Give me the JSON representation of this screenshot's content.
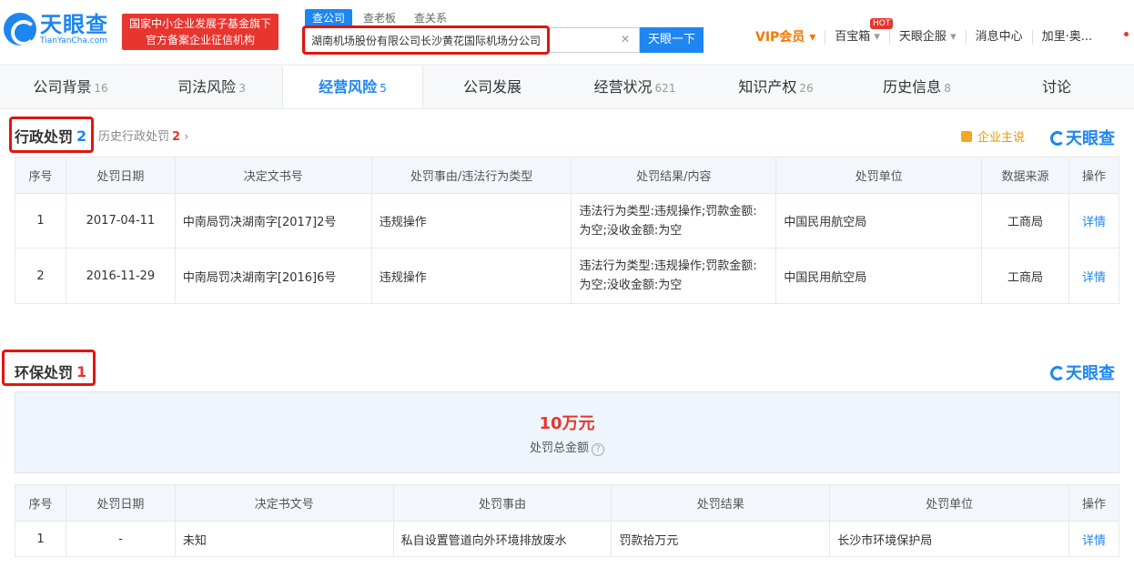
{
  "header": {
    "logo_cn": "天眼查",
    "logo_en": "TianYanCha.com",
    "badge_line1": "国家中小企业发展子基金旗下",
    "badge_line2": "官方备案企业征信机构",
    "search_tabs": [
      "查公司",
      "查老板",
      "查关系"
    ],
    "search_value": "湖南机场股份有限公司长沙黄花国际机场分公司",
    "search_button": "天眼一下",
    "vip": "VIP会员",
    "baobao": "百宝箱",
    "hot": "HOT",
    "qifu": "天眼企服",
    "messages": "消息中心",
    "user": "加里·奥..."
  },
  "tabs": [
    {
      "label": "公司背景",
      "count": "16"
    },
    {
      "label": "司法风险",
      "count": "3"
    },
    {
      "label": "经营风险",
      "count": "5"
    },
    {
      "label": "公司发展",
      "count": ""
    },
    {
      "label": "经营状况",
      "count": "621"
    },
    {
      "label": "知识产权",
      "count": "26"
    },
    {
      "label": "历史信息",
      "count": "8"
    },
    {
      "label": "讨论",
      "count": ""
    }
  ],
  "admin": {
    "title": "行政处罚",
    "count": "2",
    "history_label": "历史行政处罚",
    "history_count": "2",
    "promo": "企业主说",
    "brand": "天眼查",
    "headers": [
      "序号",
      "处罚日期",
      "决定文书号",
      "处罚事由/违法行为类型",
      "处罚结果/内容",
      "处罚单位",
      "数据来源",
      "操作"
    ],
    "rows": [
      {
        "no": "1",
        "date": "2017-04-11",
        "doc": "中南局罚决湖南字[2017]2号",
        "reason": "违规操作",
        "result_l1": "违法行为类型:违规操作;罚款金额:",
        "result_l2": "为空;没收金额:为空",
        "unit": "中国民用航空局",
        "source": "工商局",
        "action": "详情"
      },
      {
        "no": "2",
        "date": "2016-11-29",
        "doc": "中南局罚决湖南字[2016]6号",
        "reason": "违规操作",
        "result_l1": "违法行为类型:违规操作;罚款金额:",
        "result_l2": "为空;没收金额:为空",
        "unit": "中国民用航空局",
        "source": "工商局",
        "action": "详情"
      }
    ]
  },
  "env": {
    "title": "环保处罚",
    "count": "1",
    "brand": "天眼查",
    "total_value": "10万元",
    "total_label": "处罚总金额",
    "help": "?",
    "headers": [
      "序号",
      "处罚日期",
      "决定书文号",
      "处罚事由",
      "处罚结果",
      "处罚单位",
      "操作"
    ],
    "rows": [
      {
        "no": "1",
        "date": "-",
        "doc": "未知",
        "reason": "私自设置管道向外环境排放废水",
        "result": "罚款拾万元",
        "unit": "长沙市环境保护局",
        "action": "详情"
      }
    ]
  },
  "colors": {
    "accent": "#1d86f0",
    "red": "#e8352e",
    "highlight_box": "#e0160f"
  }
}
